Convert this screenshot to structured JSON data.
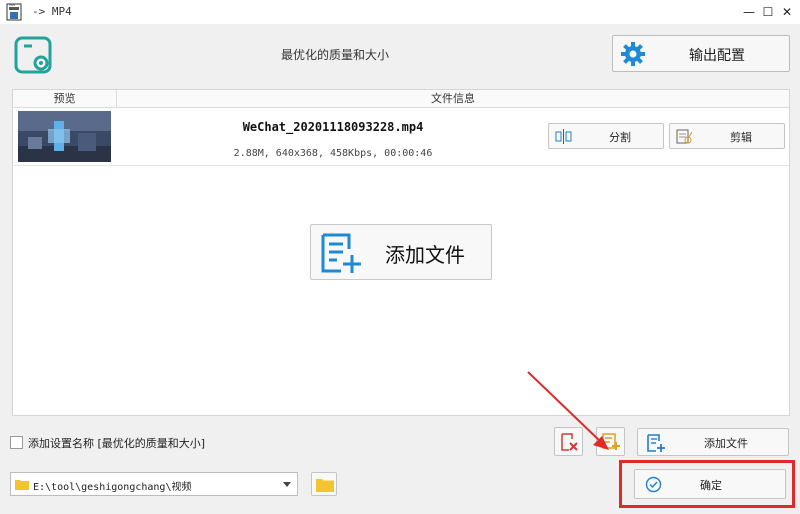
{
  "window": {
    "title": "-> MP4",
    "minimize_glyph": "—",
    "maximize_glyph": "☐",
    "close_glyph": "✕"
  },
  "header": {
    "preset_name": "最优化的质量和大小",
    "output_config_label": "输出配置"
  },
  "file_list": {
    "columns": [
      "预览",
      "文件信息"
    ],
    "files": [
      {
        "name": "WeChat_20201118093228.mp4",
        "meta": "2.88M, 640x368, 458Kbps, 00:00:46",
        "split_label": "分割",
        "trim_label": "剪辑"
      }
    ],
    "add_file_big_label": "添加文件"
  },
  "bottom": {
    "add_setting_checkbox_label": "添加设置名称 [最优化的质量和大小]",
    "add_setting_checked": false,
    "add_file_label": "添加文件",
    "output_path": "E:\\tool\\geshigongchang\\视频",
    "ok_label": "确定"
  },
  "colors": {
    "accent_teal": "#21a39a",
    "accent_blue": "#1e7fd0",
    "annotation_red": "#e02a2a",
    "folder_yellow": "#f4c430"
  },
  "annotation": {
    "type": "red-arrow-and-box",
    "target": "确定"
  }
}
